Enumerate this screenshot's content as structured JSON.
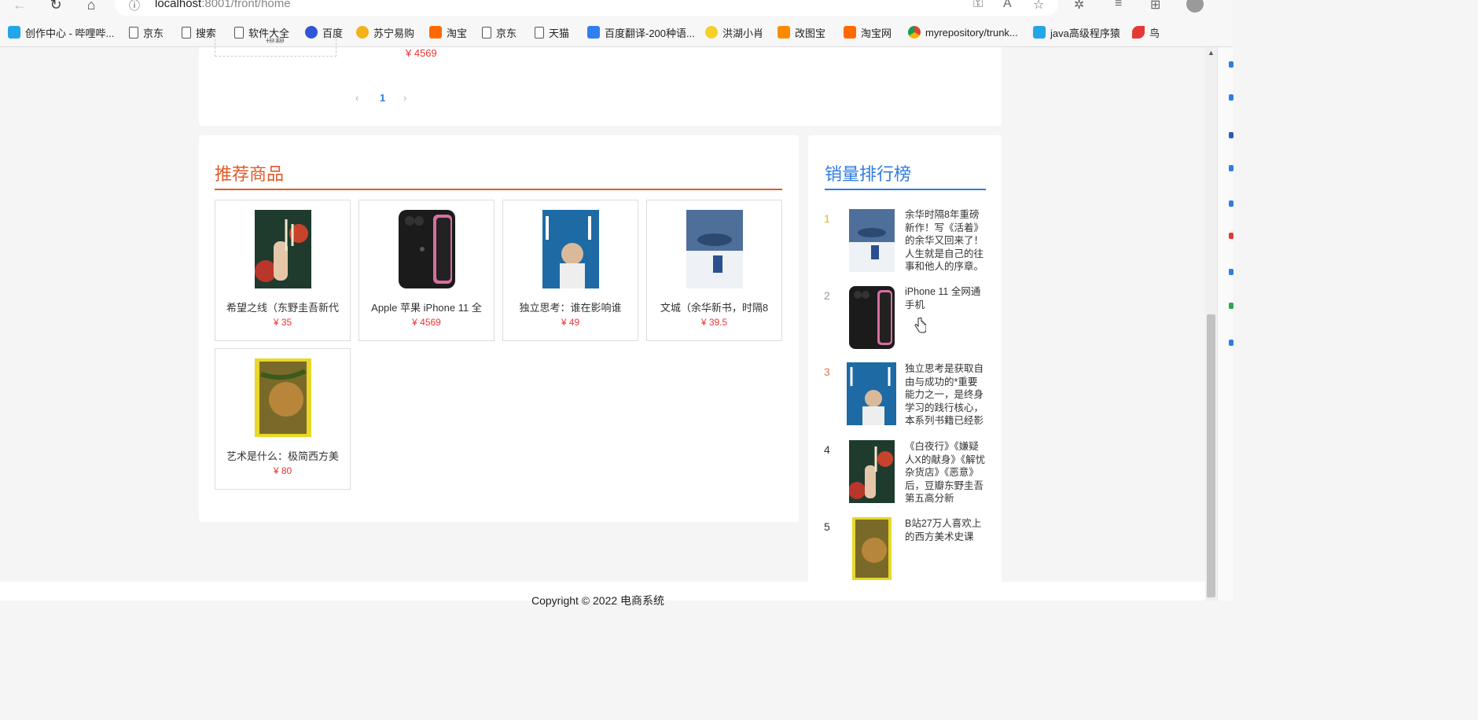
{
  "browser": {
    "url_host": "localhost",
    "url_rest": ":8001/front/home",
    "bookmarks": [
      {
        "label": "创作中心 - 哔哩哔...",
        "icon": "bilibili-icon"
      },
      {
        "label": "京东",
        "icon": "page-icon"
      },
      {
        "label": "搜索",
        "icon": "page-icon"
      },
      {
        "label": "软件大全",
        "icon": "page-icon"
      },
      {
        "label": "百度",
        "icon": "baidu-paw-icon"
      },
      {
        "label": "苏宁易购",
        "icon": "suning-icon"
      },
      {
        "label": "淘宝",
        "icon": "taobao-icon"
      },
      {
        "label": "京东",
        "icon": "page-icon"
      },
      {
        "label": "天猫",
        "icon": "page-icon"
      },
      {
        "label": "百度翻译-200种语...",
        "icon": "fanyi-icon"
      },
      {
        "label": "洪湖小肖",
        "icon": "profile-icon"
      },
      {
        "label": "改图宝",
        "icon": "gaitubao-icon"
      },
      {
        "label": "淘宝网",
        "icon": "taobao-icon"
      },
      {
        "label": "myrepository/trunk...",
        "icon": "chrome-icon"
      },
      {
        "label": "java高级程序猿",
        "icon": "bilibili-icon"
      },
      {
        "label": "鸟",
        "icon": "bird-icon"
      }
    ]
  },
  "top_section": {
    "cut_card_text": "提醒",
    "cut_price": "¥ 4569",
    "pagination": {
      "prev": "‹",
      "current": "1",
      "next": "›"
    }
  },
  "recommend": {
    "title": "推荐商品",
    "items": [
      {
        "name": "希望之线（东野圭吾新代",
        "price": "¥ 35"
      },
      {
        "name": "Apple 苹果 iPhone 11 全",
        "price": "¥ 4569"
      },
      {
        "name": "独立思考：谁在影响谁",
        "price": "¥ 49"
      },
      {
        "name": "文城（余华新书，时隔8",
        "price": "¥ 39.5"
      },
      {
        "name": "艺术是什么：极简西方美",
        "price": "¥ 80"
      }
    ]
  },
  "ranking": {
    "title": "销量排行榜",
    "items": [
      {
        "rank": "1",
        "text": "余华时隔8年重磅新作！写《活着》的余华又回来了！人生就是自己的往事和他人的序章。",
        "color": "#e6b422"
      },
      {
        "rank": "2",
        "text": "iPhone 11 全网通手机",
        "color": "#999999"
      },
      {
        "rank": "3",
        "text": "独立思考是获取自由与成功的*重要能力之一，是终身学习的践行核心，本系列书籍已经影",
        "color": "#e8734a"
      },
      {
        "rank": "4",
        "text": "《白夜行》《嫌疑人X的献身》《解忧杂货店》《恶意》后，豆瓣东野圭吾第五高分新",
        "color": "#333333"
      },
      {
        "rank": "5",
        "text": "B站27万人喜欢上的西方美术史课",
        "color": "#333333"
      }
    ]
  },
  "footer": {
    "text": "Copyright © 2022 电商系统"
  }
}
